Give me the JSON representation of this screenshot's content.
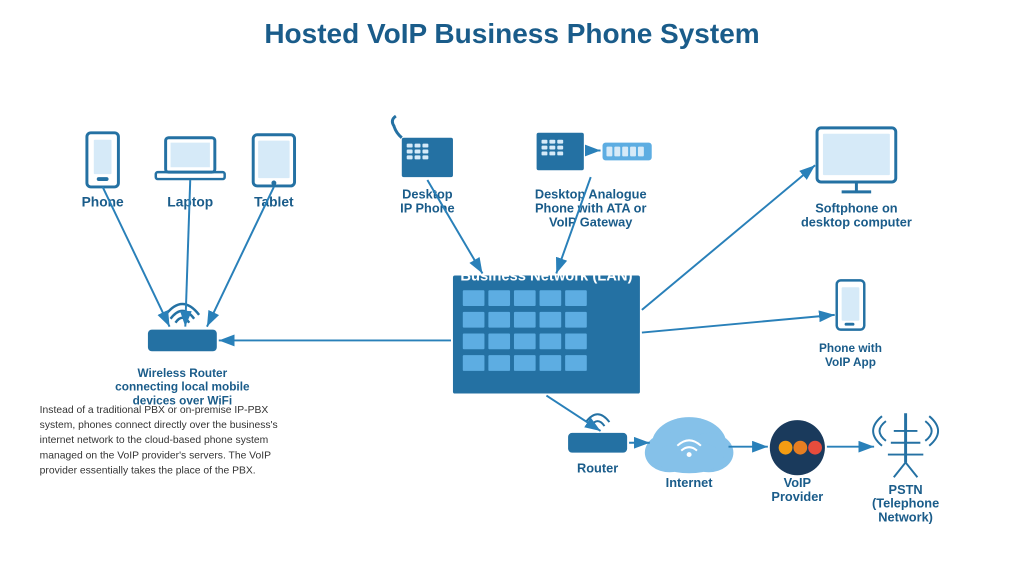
{
  "title": "Hosted VoIP Business Phone System",
  "devices": {
    "phone_label": "Phone",
    "laptop_label": "Laptop",
    "tablet_label": "Tablet",
    "desktop_ip_label": "Desktop\nIP Phone",
    "desktop_analogue_label": "Desktop Analogue\nPhone with ATA or\nVoIP Gateway",
    "softphone_label": "Softphone on\ndesktop computer",
    "wireless_router_label": "Wireless Router\nconnecting local mobile\ndevices over WiFi",
    "business_network_label": "Business Network (LAN)",
    "phone_voip_label": "Phone with\nVoIP App",
    "router_label": "Router",
    "internet_label": "Internet",
    "voip_provider_label": "VoIP\nProvider",
    "pstn_label": "PSTN\n(Telephone\nNetwork)"
  },
  "info_text": "Instead of a traditional PBX or on-premise IP-PBX system, phones connect directly over the business's internet network to the cloud-based phone system managed on the VoIP provider's servers. The VoIP provider essentially takes the place of the PBX.",
  "colors": {
    "primary_blue": "#1a5c8a",
    "medium_blue": "#2980b9",
    "light_blue": "#5dade2",
    "dark_navy": "#1a3a5c",
    "building_blue": "#2471a3",
    "arrow_blue": "#2980b9"
  }
}
